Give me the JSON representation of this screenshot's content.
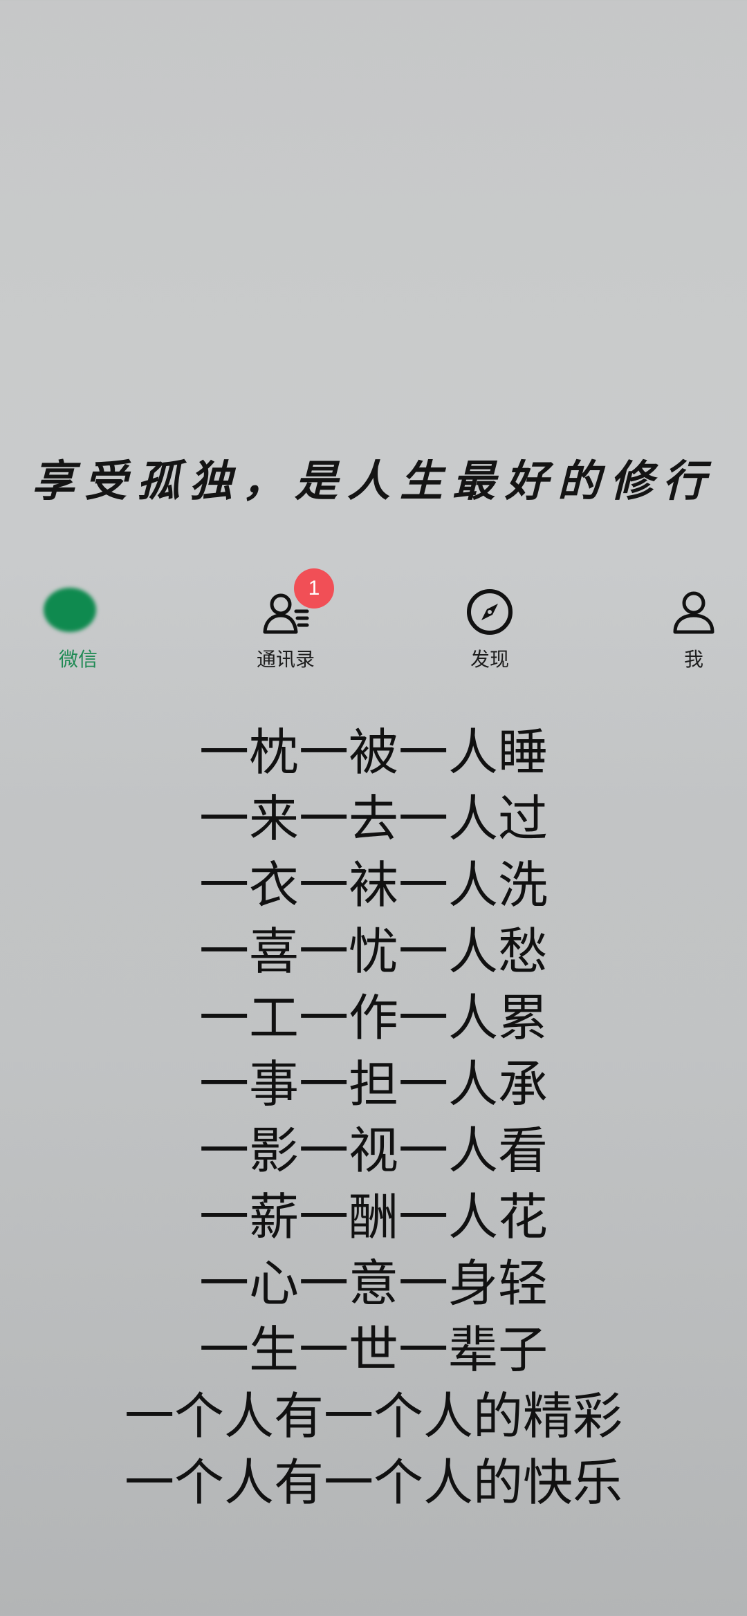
{
  "title": "享受孤独，是人生最好的修行",
  "tabbar": {
    "tabs": [
      {
        "label": "微信",
        "icon": "chat-bubble-icon"
      },
      {
        "label": "通讯录",
        "icon": "contacts-icon",
        "badge": "1"
      },
      {
        "label": "发现",
        "icon": "compass-icon"
      },
      {
        "label": "我",
        "icon": "person-icon"
      }
    ],
    "active_color": "#1f8a54",
    "badge_color": "#f14f56"
  },
  "poem": [
    "一枕一被一人睡",
    "一来一去一人过",
    "一衣一袜一人洗",
    "一喜一忧一人愁",
    "一工一作一人累",
    "一事一担一人承",
    "一影一视一人看",
    "一薪一酬一人花",
    "一心一意一身轻",
    "一生一世一辈子",
    "一个人有一个人的精彩",
    "一个人有一个人的快乐"
  ]
}
